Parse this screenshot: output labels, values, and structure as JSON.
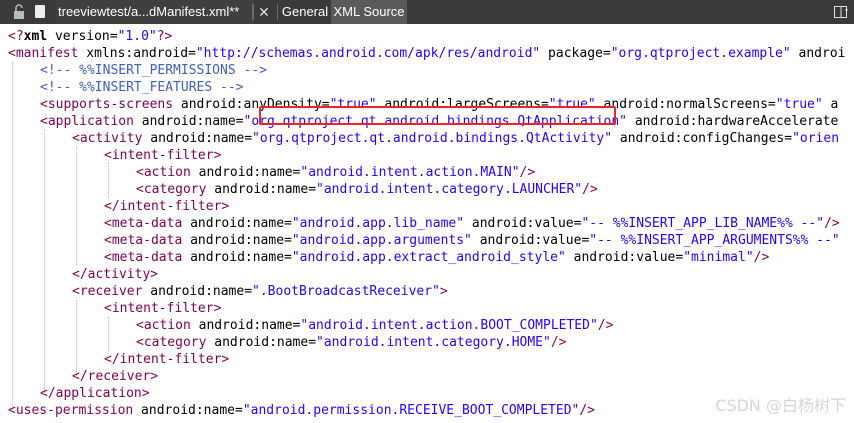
{
  "tabbar": {
    "file_tab": "treeviewtest/a...dManifest.xml**",
    "tabs": [
      "General",
      "XML Source"
    ],
    "active_tab": "XML Source"
  },
  "colors": {
    "tag": "#7f0055",
    "value": "#2a00ff",
    "comment": "#3f5fbf",
    "highlight_box": "#e8262c"
  },
  "lines": [
    [
      [
        "p",
        "<?"
      ],
      [
        "k",
        "xml"
      ],
      [
        "a",
        " version="
      ],
      [
        "v",
        "\"1.0\""
      ],
      [
        "p",
        "?>"
      ]
    ],
    [
      [
        "t",
        "<manifest"
      ],
      [
        "a",
        " xmlns:android="
      ],
      [
        "v",
        "\"http://schemas.android.com/apk/res/android\""
      ],
      [
        "a",
        " package="
      ],
      [
        "v",
        "\"org.qtproject.example\""
      ],
      [
        "a",
        " androi"
      ]
    ],
    [
      [
        "c",
        "<!-- %%INSERT_PERMISSIONS -->"
      ]
    ],
    [
      [
        "c",
        "<!-- %%INSERT_FEATURES -->"
      ]
    ],
    [
      [
        "t",
        "<supports-screens"
      ],
      [
        "a",
        " android:anyDensity="
      ],
      [
        "v",
        "\"true\""
      ],
      [
        "a",
        " android:largeScreens="
      ],
      [
        "v",
        "\"true\""
      ],
      [
        "a",
        " android:normalScreens="
      ],
      [
        "v",
        "\"true\""
      ],
      [
        "a",
        " a"
      ]
    ],
    [
      [
        "t",
        "<application"
      ],
      [
        "a",
        " android:name="
      ],
      [
        "v",
        "\"org.qtproject.qt.android.bindings.QtApplication\""
      ],
      [
        "a",
        " android:hardwareAccelerate"
      ]
    ],
    [
      [
        "t",
        "<activity"
      ],
      [
        "a",
        " android:name="
      ],
      [
        "v",
        "\"org.qtproject.qt.android.bindings.QtActivity\""
      ],
      [
        "a",
        " android:configChanges="
      ],
      [
        "v",
        "\"orien"
      ]
    ],
    [
      [
        "t",
        "<intent-filter>"
      ]
    ],
    [
      [
        "t",
        "<action"
      ],
      [
        "a",
        " android:name="
      ],
      [
        "v",
        "\"android.intent.action.MAIN\""
      ],
      [
        "t",
        "/>"
      ]
    ],
    [
      [
        "t",
        "<category"
      ],
      [
        "a",
        " android:name="
      ],
      [
        "v",
        "\"android.intent.category.LAUNCHER\""
      ],
      [
        "t",
        "/>"
      ]
    ],
    [
      [
        "t",
        "</intent-filter>"
      ]
    ],
    [
      [
        "t",
        "<meta-data"
      ],
      [
        "a",
        " android:name="
      ],
      [
        "v",
        "\"android.app.lib_name\""
      ],
      [
        "a",
        " android:value="
      ],
      [
        "v",
        "\"-- %%INSERT_APP_LIB_NAME%% --\""
      ],
      [
        "t",
        "/>"
      ]
    ],
    [
      [
        "t",
        "<meta-data"
      ],
      [
        "a",
        " android:name="
      ],
      [
        "v",
        "\"android.app.arguments\""
      ],
      [
        "a",
        " android:value="
      ],
      [
        "v",
        "\"-- %%INSERT_APP_ARGUMENTS%% --\""
      ]
    ],
    [
      [
        "t",
        "<meta-data"
      ],
      [
        "a",
        " android:name="
      ],
      [
        "v",
        "\"android.app.extract_android_style\""
      ],
      [
        "a",
        " android:value="
      ],
      [
        "v",
        "\"minimal\""
      ],
      [
        "t",
        "/>"
      ]
    ],
    [
      [
        "t",
        "</activity>"
      ]
    ],
    [
      [
        "t",
        "<receiver"
      ],
      [
        "a",
        " android:name="
      ],
      [
        "v",
        "\".BootBroadcastReceiver\""
      ],
      [
        "t",
        ">"
      ]
    ],
    [
      [
        "t",
        "<intent-filter>"
      ]
    ],
    [
      [
        "t",
        "<action"
      ],
      [
        "a",
        " android:name="
      ],
      [
        "v",
        "\"android.intent.action.BOOT_COMPLETED\""
      ],
      [
        "t",
        "/>"
      ]
    ],
    [
      [
        "t",
        "<category"
      ],
      [
        "a",
        " android:name="
      ],
      [
        "v",
        "\"android.intent.category.HOME\""
      ],
      [
        "t",
        "/>"
      ]
    ],
    [
      [
        "t",
        "</intent-filter>"
      ]
    ],
    [
      [
        "t",
        "</receiver>"
      ]
    ],
    [
      [
        "t",
        "</application>"
      ]
    ],
    [
      [
        "t",
        "<uses-permission"
      ],
      [
        "a",
        " android:name="
      ],
      [
        "v",
        "\"android.permission.RECEIVE_BOOT_COMPLETED\""
      ],
      [
        "t",
        "/>"
      ]
    ]
  ],
  "watermark": "CSDN @\u0006白杨树下\u0006"
}
